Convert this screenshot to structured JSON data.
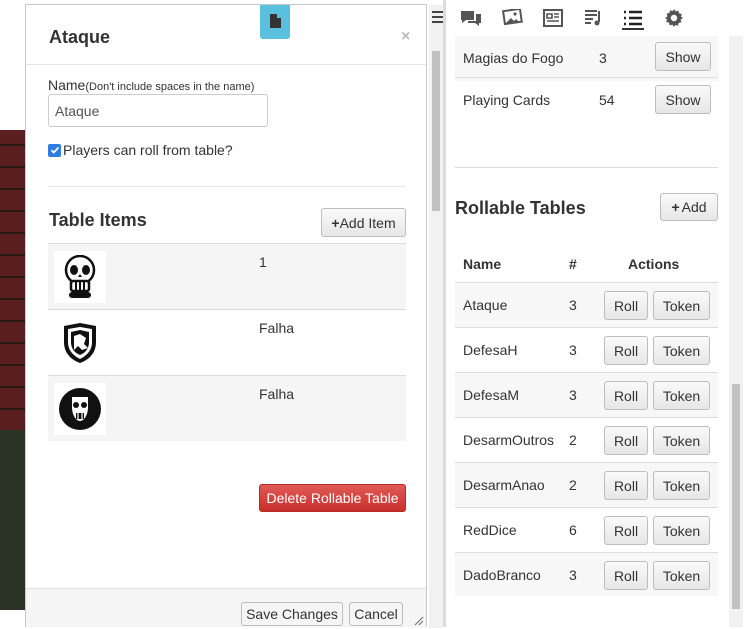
{
  "dialog": {
    "title": "Ataque",
    "close_label": "×",
    "name_label": "Name",
    "name_hint": "(Don't include spaces in the name)",
    "name_value": "Ataque",
    "checkbox_label": "Players can roll from table?",
    "checkbox_checked": true,
    "items_title": "Table Items",
    "add_item_label": "Add Item",
    "items": [
      {
        "icon": "skull-icon",
        "value": "1"
      },
      {
        "icon": "shield-crest-icon",
        "value": "Falha"
      },
      {
        "icon": "mask-icon",
        "value": "Falha"
      }
    ],
    "delete_label": "Delete Rollable Table",
    "save_label": "Save Changes",
    "cancel_label": "Cancel"
  },
  "toolbar": {
    "icons": [
      "chat-icon",
      "image-icon",
      "journal-icon",
      "music-icon",
      "list-icon",
      "gear-icon"
    ],
    "active": "list-icon"
  },
  "decks": [
    {
      "name": "Magias do Fogo",
      "count": "3",
      "action": "Show"
    },
    {
      "name": "Playing Cards",
      "count": "54",
      "action": "Show"
    }
  ],
  "rollable": {
    "title": "Rollable Tables",
    "add_label": "Add",
    "headers": {
      "name": "Name",
      "count": "#",
      "actions": "Actions"
    },
    "roll_label": "Roll",
    "token_label": "Token",
    "rows": [
      {
        "name": "Ataque",
        "count": "3"
      },
      {
        "name": "DefesaH",
        "count": "3"
      },
      {
        "name": "DefesaM",
        "count": "3"
      },
      {
        "name": "DesarmOutros",
        "count": "2"
      },
      {
        "name": "DesarmAnao",
        "count": "2"
      },
      {
        "name": "RedDice",
        "count": "6"
      },
      {
        "name": "DadoBranco",
        "count": "3"
      }
    ]
  },
  "colors": {
    "accent_tab": "#5bc0de",
    "danger": "#d9534f",
    "checkbox": "#2f7de1"
  }
}
